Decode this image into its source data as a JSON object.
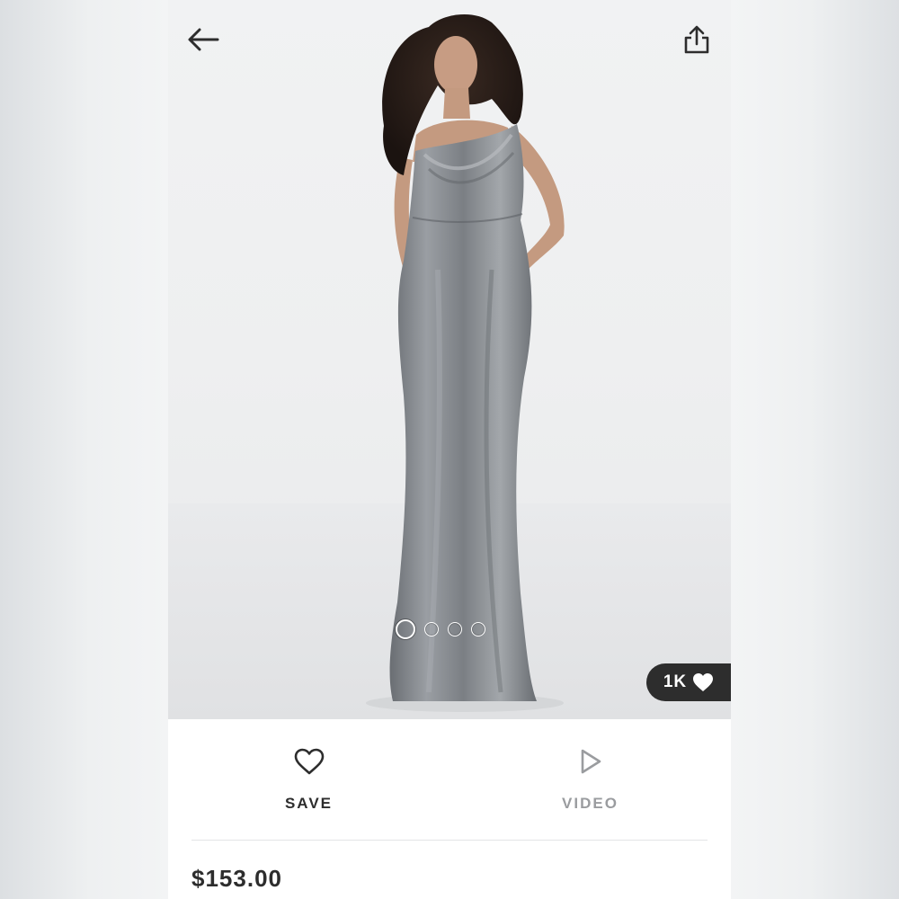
{
  "header": {
    "back_icon": "arrow-left-icon",
    "share_icon": "share-icon"
  },
  "gallery": {
    "image_count": 4,
    "active_index": 0,
    "likes_label": "1K",
    "likes_icon": "heart-filled-icon"
  },
  "actions": {
    "save_label": "SAVE",
    "save_icon": "heart-outline-icon",
    "video_label": "VIDEO",
    "video_icon": "play-icon"
  },
  "product": {
    "price": "$153.00"
  },
  "colors": {
    "text_dark": "#2d2d2d",
    "text_muted": "#9a9c9f",
    "badge_bg": "#2d2d2d",
    "dress": "#7d8186"
  }
}
